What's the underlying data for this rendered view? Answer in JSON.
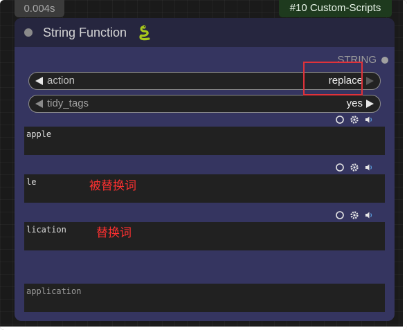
{
  "execution_time": "0.004s",
  "node_badge": "#10 Custom-Scripts",
  "node": {
    "title": "String Function",
    "title_icon": "snake-icon",
    "output_label": "STRING"
  },
  "widgets": {
    "action": {
      "name": "action",
      "value": "replace"
    },
    "tidy_tags": {
      "name": "tidy_tags",
      "value": "yes"
    }
  },
  "text_inputs": [
    {
      "value": "apple",
      "annotation": ""
    },
    {
      "value": "le",
      "annotation": "被替换词"
    },
    {
      "value": "lication",
      "annotation": "替换词"
    }
  ],
  "result_preview": "application",
  "icons": [
    "circle-icon",
    "gear-icon",
    "speaker-icon"
  ],
  "colors": {
    "node_body": "#353560",
    "node_header": "#26263f",
    "highlight": "#e0323a",
    "annotation": "#ff3030",
    "badge_green": "#1e3a1e"
  }
}
